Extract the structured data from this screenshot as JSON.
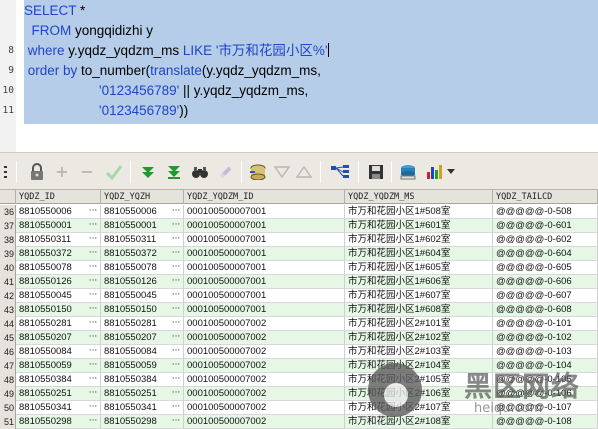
{
  "editor": {
    "lines": [
      {
        "num": "",
        "tokens": [
          {
            "t": "SELECT",
            "k": "kw"
          },
          {
            "t": " *",
            "k": "id"
          }
        ]
      },
      {
        "num": "",
        "tokens": [
          {
            "t": "  FROM",
            "k": "kw"
          },
          {
            "t": " yongqidizhi y",
            "k": "id"
          }
        ]
      },
      {
        "num": "8",
        "tokens": [
          {
            "t": " where",
            "k": "kw"
          },
          {
            "t": " y.yqdz_yqdzm_ms ",
            "k": "id"
          },
          {
            "t": "LIKE",
            "k": "kw"
          },
          {
            "t": " '市万和花园小区%'",
            "k": "str"
          }
        ]
      },
      {
        "num": "9",
        "tokens": [
          {
            "t": " order by",
            "k": "kw"
          },
          {
            "t": " to_number(",
            "k": "id"
          },
          {
            "t": "translate",
            "k": "fn"
          },
          {
            "t": "(y.yqdz_yqdzm_ms,",
            "k": "id"
          }
        ]
      },
      {
        "num": "10",
        "tokens": [
          {
            "t": "                    '0123456789'",
            "k": "str"
          },
          {
            "t": " || y.yqdz_yqdzm_ms,",
            "k": "id"
          }
        ]
      },
      {
        "num": "11",
        "tokens": [
          {
            "t": "                    '0123456789'",
            "k": "str"
          },
          {
            "t": "))",
            "k": "id"
          }
        ]
      }
    ]
  },
  "toolbar": {
    "icons": [
      "grid-menu-icon",
      "lock-icon",
      "add-row-icon",
      "delete-row-icon",
      "post-check-icon",
      "next-page-icon",
      "last-page-icon",
      "find-icon",
      "clear-icon",
      "query-by-example-icon",
      "filter-up-icon",
      "filter-down-icon",
      "explain-icon",
      "save-icon",
      "export-icon",
      "chart-icon"
    ]
  },
  "grid": {
    "columns": [
      "YQDZ_ID",
      "YQDZ_YQZH",
      "YQDZ_YQDZM_ID",
      "YQDZ_YQDZM_MS",
      "YQDZ_TAILCD"
    ],
    "rows": [
      {
        "n": "36",
        "c": [
          "8810550006",
          "8810550006",
          "000100500007001",
          "市万和花园小区1#508室",
          "@@@@@-0-508"
        ]
      },
      {
        "n": "37",
        "c": [
          "8810550001",
          "8810550001",
          "000100500007001",
          "市万和花园小区1#601室",
          "@@@@@-0-601"
        ]
      },
      {
        "n": "38",
        "c": [
          "8810550311",
          "8810550311",
          "000100500007001",
          "市万和花园小区1#602室",
          "@@@@@-0-602"
        ]
      },
      {
        "n": "39",
        "c": [
          "8810550372",
          "8810550372",
          "000100500007001",
          "市万和花园小区1#604室",
          "@@@@@-0-604"
        ]
      },
      {
        "n": "40",
        "c": [
          "8810550078",
          "8810550078",
          "000100500007001",
          "市万和花园小区1#605室",
          "@@@@@-0-605"
        ]
      },
      {
        "n": "41",
        "c": [
          "8810550126",
          "8810550126",
          "000100500007001",
          "市万和花园小区1#606室",
          "@@@@@-0-606"
        ]
      },
      {
        "n": "42",
        "c": [
          "8810550045",
          "8810550045",
          "000100500007001",
          "市万和花园小区1#607室",
          "@@@@@-0-607"
        ]
      },
      {
        "n": "43",
        "c": [
          "8810550150",
          "8810550150",
          "000100500007001",
          "市万和花园小区1#608室",
          "@@@@@-0-608"
        ]
      },
      {
        "n": "44",
        "c": [
          "8810550281",
          "8810550281",
          "000100500007002",
          "市万和花园小区2#101室",
          "@@@@@-0-101"
        ]
      },
      {
        "n": "45",
        "c": [
          "8810550207",
          "8810550207",
          "000100500007002",
          "市万和花园小区2#102室",
          "@@@@@-0-102"
        ]
      },
      {
        "n": "46",
        "c": [
          "8810550084",
          "8810550084",
          "000100500007002",
          "市万和花园小区2#103室",
          "@@@@@-0-103"
        ]
      },
      {
        "n": "47",
        "c": [
          "8810550059",
          "8810550059",
          "000100500007002",
          "市万和花园小区2#104室",
          "@@@@@-0-104"
        ]
      },
      {
        "n": "48",
        "c": [
          "8810550384",
          "8810550384",
          "000100500007002",
          "市万和花园小区2#105室",
          "@@@@@-0-105"
        ]
      },
      {
        "n": "49",
        "c": [
          "8810550251",
          "8810550251",
          "000100500007002",
          "市万和花园小区2#106室",
          "@@@@@-0-106"
        ]
      },
      {
        "n": "50",
        "c": [
          "8810550341",
          "8810550341",
          "000100500007002",
          "市万和花园小区2#107室",
          "@@@@@-0-107"
        ]
      },
      {
        "n": "51",
        "c": [
          "8810550298",
          "8810550298",
          "000100500007002",
          "市万和花园小区2#108室",
          "@@@@@-0-108"
        ]
      }
    ]
  },
  "watermark": {
    "title": "黑区网络",
    "url": "heiqu.com"
  }
}
